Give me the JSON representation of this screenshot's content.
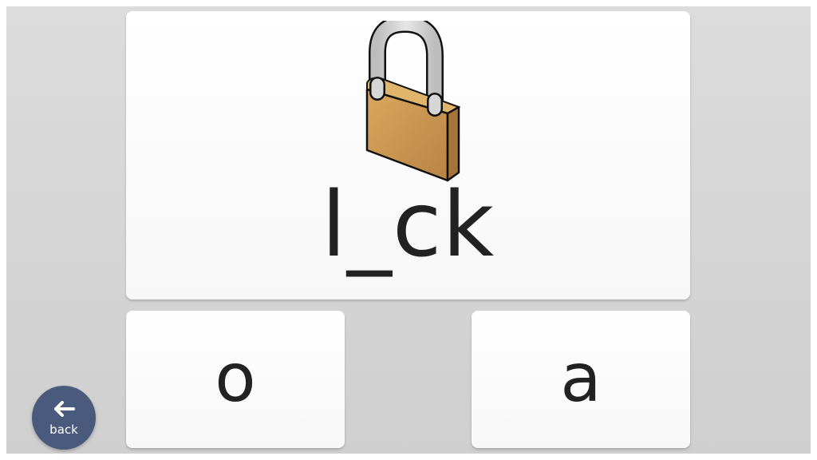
{
  "prompt": {
    "word": "l_ck",
    "image_icon": "padlock-icon"
  },
  "choices": [
    {
      "label": "o"
    },
    {
      "label": "a"
    }
  ],
  "navigation": {
    "back_label": "back",
    "back_icon": "arrow-left-icon"
  },
  "colors": {
    "background": "#d4d4d4",
    "card": "#ffffff",
    "text": "#222222",
    "back_button": "#4a5a7d",
    "lock_body": "#c8964e",
    "lock_shackle": "#d0d0d0"
  }
}
